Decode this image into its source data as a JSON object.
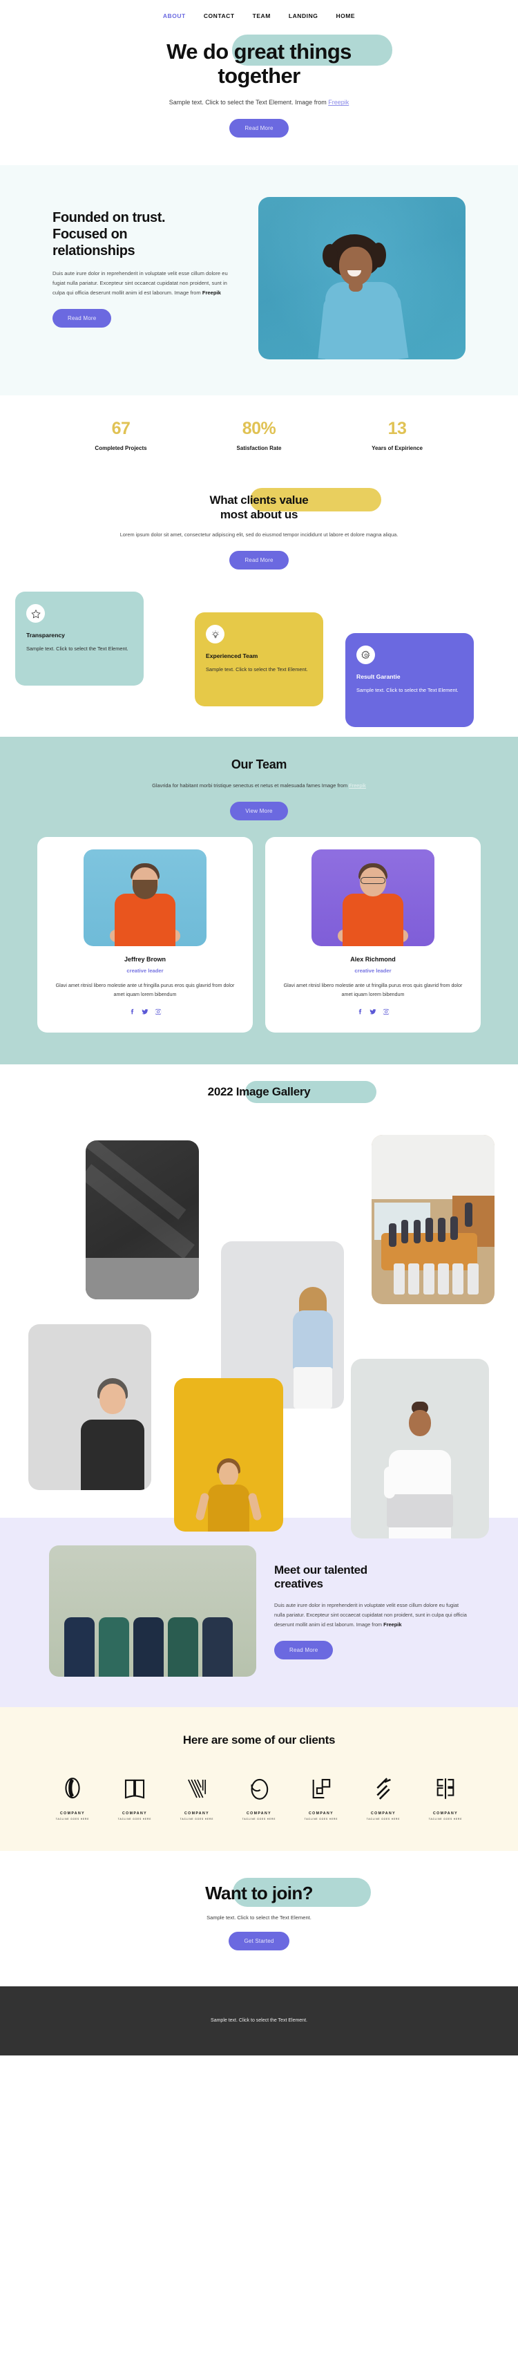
{
  "nav": {
    "items": [
      {
        "label": "ABOUT",
        "active": true
      },
      {
        "label": "CONTACT",
        "active": false
      },
      {
        "label": "TEAM",
        "active": false
      },
      {
        "label": "LANDING",
        "active": false
      },
      {
        "label": "HOME",
        "active": false
      }
    ]
  },
  "hero": {
    "title_line1": "We do great things",
    "title_line2": "together",
    "subtitle": "Sample text. Click to select the Text Element. Image from ",
    "subtitle_link": "Freepik",
    "button": "Read More",
    "highlight_color": "#b0d8d4"
  },
  "founded": {
    "title_line1": "Founded on trust.",
    "title_line2": "Focused on",
    "title_line3": "relationships",
    "body": "Duis aute irure dolor in reprehenderit in voluptate velit esse cillum dolore eu fugiat nulla pariatur. Excepteur sint occaecat cupidatat non proident, sunt in culpa qui officia deserunt mollit anim id est laborum. Image from ",
    "body_bold": "Freepik",
    "button": "Read More",
    "bg_color": "#f3fafa",
    "image_bg_color": "#4eaec9"
  },
  "stats": {
    "accent_color": "#e0c254",
    "items": [
      {
        "value": "67",
        "label": "Completed Projects"
      },
      {
        "value": "80%",
        "label": "Satisfaction Rate"
      },
      {
        "value": "13",
        "label": "Years of Expirience"
      }
    ]
  },
  "values": {
    "title_line1": "What clients value",
    "title_line2": "most about us",
    "body": "Lorem ipsum dolor sit amet, consectetur adipiscing elit, sed do eiusmod tempor incididunt ut labore et dolore magna aliqua.",
    "button": "Read More",
    "highlight_color": "#e9cf5e",
    "cards": [
      {
        "icon": "star-icon",
        "title": "Transparency",
        "text": "Sample text. Click to select the Text Element.",
        "color": "#b0d8d4"
      },
      {
        "icon": "lightbulb-icon",
        "title": "Experienced Team",
        "text": "Sample text. Click to select the Text Element.",
        "color": "#e6c948"
      },
      {
        "icon": "gear-icon",
        "title": "Result Garantie",
        "text": "Sample text. Click to select the Text Element.",
        "color": "#6b69e0"
      }
    ]
  },
  "team": {
    "title": "Our Team",
    "subtitle": "Glavrida for habitant morbi tristique senectus et netus et malesuada fames Image from ",
    "subtitle_link": "Freepik",
    "button": "View More",
    "bg_color": "#b4d8d3",
    "members": [
      {
        "name": "Jeffrey Brown",
        "role": "creative leader",
        "desc": "Glavi amet ritnisl libero molestie ante ut fringilla purus eros quis glavrid from dolor amet iquam lorem bibendum",
        "socials": [
          "facebook-icon",
          "twitter-icon",
          "instagram-icon"
        ]
      },
      {
        "name": "Alex Richmond",
        "role": "creative leader",
        "desc": "Glavi amet ritnisl libero molestie ante ut fringilla purus eros quis glavrid from dolor amet iquam lorem bibendum",
        "socials": [
          "facebook-icon",
          "twitter-icon",
          "instagram-icon"
        ]
      }
    ]
  },
  "gallery": {
    "title": "2022 Image Gallery",
    "highlight_color": "#b0d8d4",
    "images": [
      {
        "alt": "dark-room-with-light-shafts"
      },
      {
        "alt": "conference-room-meeting"
      },
      {
        "alt": "woman-in-blue-shirt"
      },
      {
        "alt": "man-in-black-tshirt"
      },
      {
        "alt": "surprised-woman-yellow-background"
      },
      {
        "alt": "woman-with-laptop-celebrating"
      }
    ]
  },
  "creatives": {
    "title_line1": "Meet our talented",
    "title_line2": "creatives",
    "body": "Duis aute irure dolor in reprehenderit in voluptate velit esse cillum dolore eu fugiat nulla pariatur. Excepteur sint occaecat cupidatat non proident, sunt in culpa qui officia deserunt mollit anim id est laborum. Image from ",
    "body_bold": "Freepik",
    "button": "Read More",
    "bg_color": "#eceafb"
  },
  "clients": {
    "title": "Here are some of our clients",
    "bg_color": "#fdf8e8",
    "logos": [
      {
        "icon": "logo-circle-mark",
        "name": "COMPANY",
        "tagline": "TAGLINE GOES HERE"
      },
      {
        "icon": "logo-book-mark",
        "name": "COMPANY",
        "tagline": "TAGLINE GOES HERE"
      },
      {
        "icon": "logo-v-lines-mark",
        "name": "COMPANY",
        "tagline": "TAGLINE GOES HERE"
      },
      {
        "icon": "logo-oval-mark",
        "name": "COMPANY",
        "tagline": "TAGLINE GOES HERE"
      },
      {
        "icon": "logo-squares-mark",
        "name": "COMPANY",
        "tagline": "TAGLINE GOES HERE"
      },
      {
        "icon": "logo-slashes-mark",
        "name": "COMPANY",
        "tagline": "TAGLINE GOES HERE"
      },
      {
        "icon": "logo-bracket-mark",
        "name": "COMPANY",
        "tagline": "TAGLINE GOES HERE"
      }
    ]
  },
  "join": {
    "title": "Want to join?",
    "subtitle": "Sample text. Click to select the Text Element.",
    "button": "Get Started",
    "highlight_color": "#b0d8d4"
  },
  "footer": {
    "text": "Sample text. Click to select the Text Element.",
    "bg_color": "#333333"
  }
}
